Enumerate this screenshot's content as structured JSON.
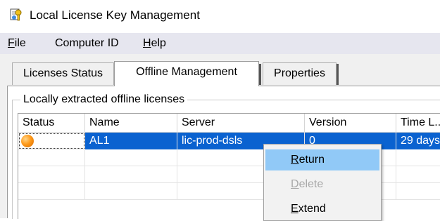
{
  "window": {
    "title": "Local License Key Management",
    "icon": "license-key-app-icon"
  },
  "menubar": {
    "items": [
      {
        "mnemonic": "F",
        "rest": "ile"
      },
      {
        "prefix": "Computer ID"
      },
      {
        "mnemonic": "H",
        "rest": "elp"
      }
    ]
  },
  "tabs": [
    {
      "label": "Licenses Status",
      "active": false
    },
    {
      "label": "Offline Management",
      "active": true
    },
    {
      "label": "Properties",
      "active": false
    }
  ],
  "group": {
    "title": "Locally extracted offline licenses"
  },
  "table": {
    "columns": [
      "Status",
      "Name",
      "Server",
      "Version",
      "Time L..."
    ],
    "rows": [
      {
        "status_icon": "orange-status-dot-icon",
        "name": "AL1",
        "server": "lic-prod-dsls",
        "version": "0",
        "time_left": "29 days ..."
      }
    ]
  },
  "context_menu": {
    "items": [
      {
        "mnemonic": "R",
        "rest": "eturn",
        "enabled": true,
        "hover": true
      },
      {
        "mnemonic": "D",
        "rest": "elete",
        "enabled": false,
        "hover": false
      },
      {
        "mnemonic": "E",
        "rest": "xtend",
        "enabled": true,
        "hover": false
      }
    ]
  },
  "colors": {
    "menubar_bg": "#e6e6ef",
    "selection": "#0a62d0",
    "menu_hover": "#91c9f7",
    "status_dot": "#ff9a1a"
  }
}
